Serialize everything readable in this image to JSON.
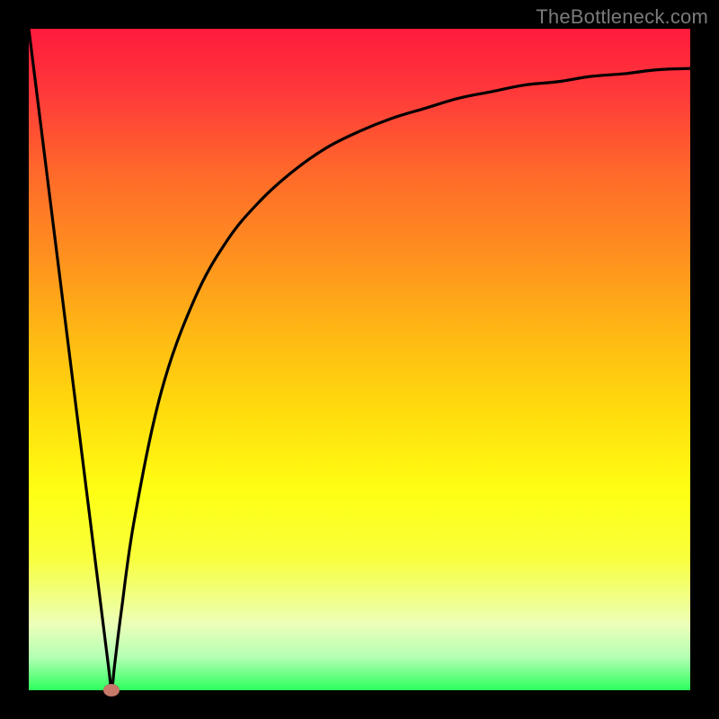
{
  "watermark": "TheBottleneck.com",
  "colors": {
    "gradient_top": "#ff1a3c",
    "gradient_mid": "#ffff14",
    "gradient_bottom": "#2cff5c",
    "curve": "#000000",
    "marker": "#c87a6a",
    "frame": "#000000"
  },
  "chart_data": {
    "type": "line",
    "title": "",
    "xlabel": "",
    "ylabel": "",
    "xlim": [
      0,
      100
    ],
    "ylim": [
      0,
      100
    ],
    "grid": false,
    "legend": false,
    "series": [
      {
        "name": "curve",
        "x": [
          0,
          3,
          6,
          9,
          12,
          12.5,
          13,
          14,
          16,
          20,
          25,
          30,
          35,
          40,
          45,
          50,
          55,
          60,
          65,
          70,
          75,
          80,
          85,
          90,
          95,
          100
        ],
        "y": [
          100,
          76,
          52,
          28,
          4,
          0,
          4,
          12,
          26,
          45,
          59,
          68,
          74,
          78.5,
          82,
          84.5,
          86.5,
          88,
          89.5,
          90.5,
          91.5,
          92,
          92.8,
          93.2,
          93.8,
          94
        ]
      }
    ],
    "marker": {
      "x": 12.5,
      "y": 0,
      "color": "#c87a6a"
    },
    "background": {
      "type": "vertical-gradient",
      "stops": [
        "#ff1a3c",
        "#ffff14",
        "#2cff5c"
      ]
    }
  }
}
